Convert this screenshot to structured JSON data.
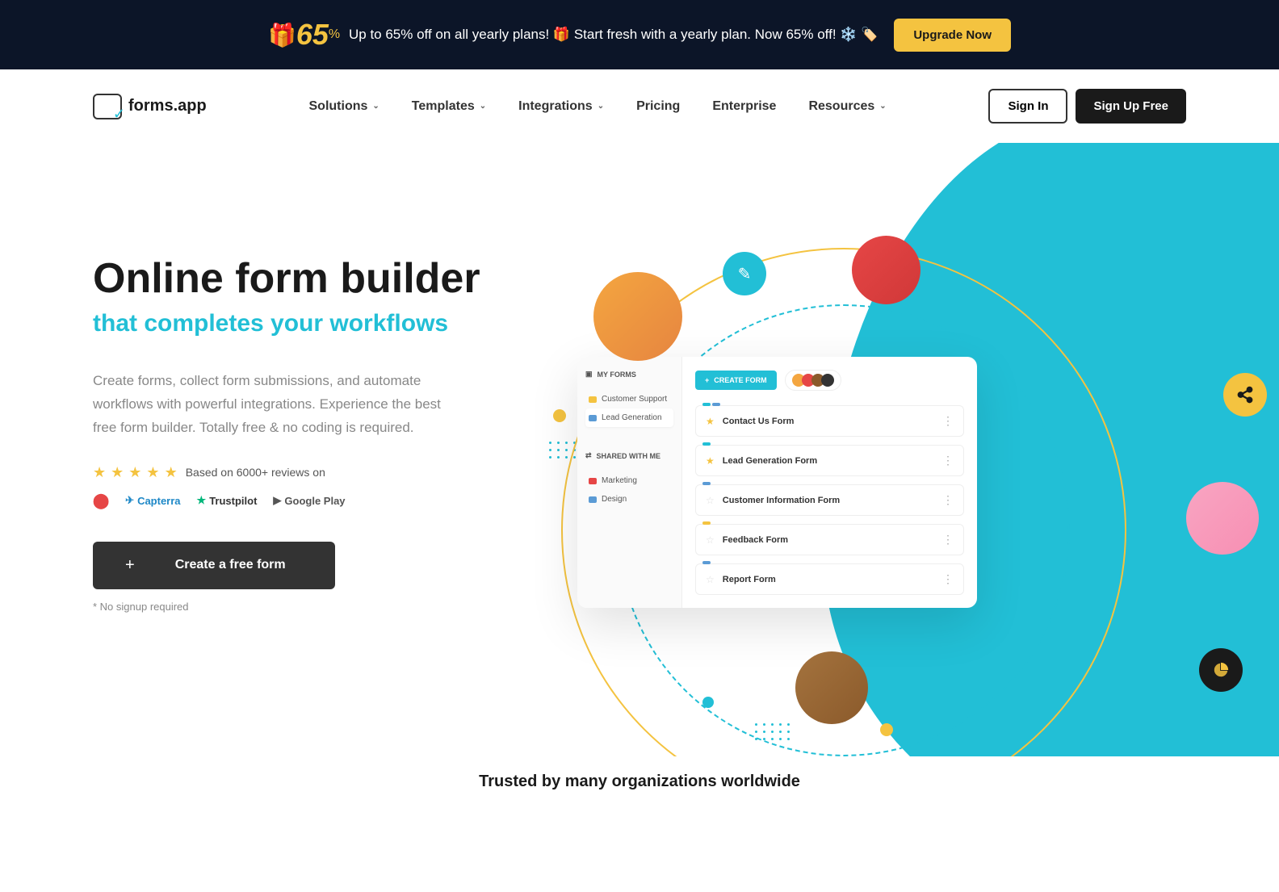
{
  "promo": {
    "percent": "65",
    "percent_sign": "%",
    "text": "Up to 65% off on all yearly plans! 🎁 Start fresh with a yearly plan. Now 65% off! ❄️ 🏷️",
    "cta": "Upgrade Now"
  },
  "logo": {
    "text": "forms.app"
  },
  "nav": {
    "solutions": "Solutions",
    "templates": "Templates",
    "integrations": "Integrations",
    "pricing": "Pricing",
    "enterprise": "Enterprise",
    "resources": "Resources"
  },
  "auth": {
    "signin": "Sign In",
    "signup": "Sign Up Free"
  },
  "hero": {
    "title": "Online form builder",
    "subtitle": "that completes your workflows",
    "desc": "Create forms, collect form submissions, and automate workflows with powerful integrations. Experience the best free form builder. Totally free & no coding is required.",
    "rating_text": "Based on 6000+ reviews on",
    "cta": "Create a free form",
    "note": "* No signup required"
  },
  "platforms": {
    "g2": "G2",
    "capterra": "Capterra",
    "trustpilot": "Trustpilot",
    "googleplay": "Google Play"
  },
  "mockup": {
    "sidebar": {
      "myforms": "MY FORMS",
      "shared": "SHARED WITH ME",
      "items1": [
        "Customer Support",
        "Lead Generation"
      ],
      "items2": [
        "Marketing",
        "Design"
      ]
    },
    "create": "CREATE FORM",
    "forms": [
      "Contact Us Form",
      "Lead Generation Form",
      "Customer Information Form",
      "Feedback Form",
      "Report Form"
    ]
  },
  "trusted": "Trusted by many organizations worldwide"
}
